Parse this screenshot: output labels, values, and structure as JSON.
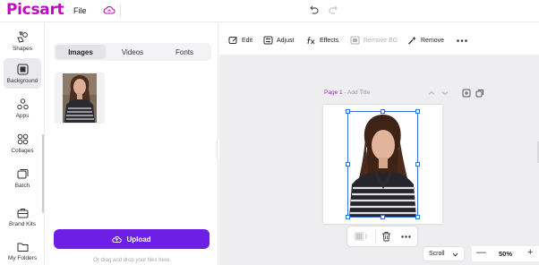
{
  "app": {
    "logo": "Picsart",
    "brand_color": "#c209c1",
    "accent_color": "#6e1fe6",
    "selection_color": "#2f6fe0"
  },
  "header": {
    "file_menu": "File"
  },
  "rail": {
    "items": [
      {
        "label": "Shapes",
        "icon": "shapes-icon"
      },
      {
        "label": "Background",
        "icon": "background-icon",
        "active": true
      },
      {
        "label": "Apps",
        "icon": "apps-icon"
      },
      {
        "label": "Collages",
        "icon": "collages-icon"
      },
      {
        "label": "Batch",
        "icon": "batch-icon"
      },
      {
        "label": "Brand Kits",
        "icon": "brand-kits-icon"
      },
      {
        "label": "My Folders",
        "icon": "folder-icon"
      }
    ]
  },
  "panel": {
    "tabs": [
      {
        "label": "Images",
        "active": true
      },
      {
        "label": "Videos"
      },
      {
        "label": "Fonts"
      }
    ],
    "upload_label": "Upload",
    "drop_hint": "Or drag and drop your files here."
  },
  "toolbar": {
    "edit": "Edit",
    "adjust": "Adjust",
    "effects": "Effects",
    "remove_bg": "Remove BG",
    "remove": "Remove"
  },
  "canvas": {
    "page_name": "Page 1",
    "add_title": "- Add Title",
    "scroll_mode": "Scroll",
    "zoom": "50%",
    "zoom_minus": "—",
    "zoom_plus": "+"
  }
}
